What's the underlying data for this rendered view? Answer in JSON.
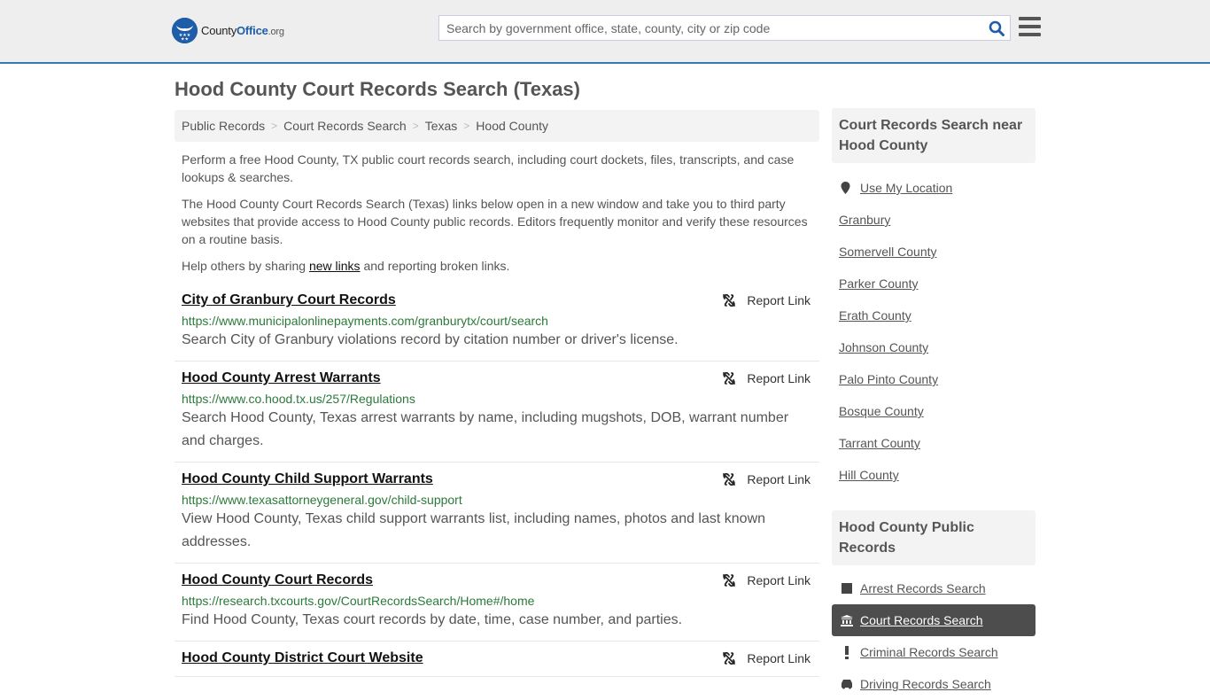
{
  "header": {
    "logo": {
      "part1": "County",
      "part2": "Office",
      "part3": ".org"
    },
    "search": {
      "placeholder": "Search by government office, state, county, city or zip code",
      "value": ""
    }
  },
  "page_title": "Hood County Court Records Search (Texas)",
  "breadcrumb": [
    {
      "label": "Public Records"
    },
    {
      "label": "Court Records Search"
    },
    {
      "label": "Texas"
    },
    {
      "label": "Hood County"
    }
  ],
  "intro": {
    "p1": "Perform a free Hood County, TX public court records search, including court dockets, files, transcripts, and case lookups & searches.",
    "p2": "The Hood County Court Records Search (Texas) links below open in a new window and take you to third party websites that provide access to Hood County public records. Editors frequently monitor and verify these resources on a routine basis.",
    "p3_before": "Help others by sharing ",
    "p3_link": "new links",
    "p3_after": " and reporting broken links."
  },
  "report_label": "Report Link",
  "results": [
    {
      "title": "City of Granbury Court Records",
      "url": "https://www.municipalonlinepayments.com/granburytx/court/search",
      "desc": "Search City of Granbury violations record by citation number or driver's license."
    },
    {
      "title": "Hood County Arrest Warrants",
      "url": "https://www.co.hood.tx.us/257/Regulations",
      "desc": "Search Hood County, Texas arrest warrants by name, including mugshots, DOB, warrant number and charges."
    },
    {
      "title": "Hood County Child Support Warrants",
      "url": "https://www.texasattorneygeneral.gov/child-support",
      "desc": "View Hood County, Texas child support warrants list, including names, photos and last known addresses."
    },
    {
      "title": "Hood County Court Records",
      "url": "https://research.txcourts.gov/CourtRecordsSearch/Home#/home",
      "desc": "Find Hood County, Texas court records by date, time, case number, and parties."
    },
    {
      "title": "Hood County District Court Website",
      "url": "",
      "desc": ""
    }
  ],
  "sidebar": {
    "nearby_heading": "Court Records Search near Hood County",
    "use_location": "Use My Location",
    "nearby": [
      "Granbury",
      "Somervell County",
      "Parker County",
      "Erath County",
      "Johnson County",
      "Palo Pinto County",
      "Bosque County",
      "Tarrant County",
      "Hill County"
    ],
    "public_heading": "Hood County Public Records",
    "public_records": [
      {
        "label": "Arrest Records Search",
        "icon": "square-icon",
        "active": false
      },
      {
        "label": "Court Records Search",
        "icon": "courthouse-icon",
        "active": true
      },
      {
        "label": "Criminal Records Search",
        "icon": "exclamation-icon",
        "active": false
      },
      {
        "label": "Driving Records Search",
        "icon": "car-icon",
        "active": false
      }
    ]
  }
}
